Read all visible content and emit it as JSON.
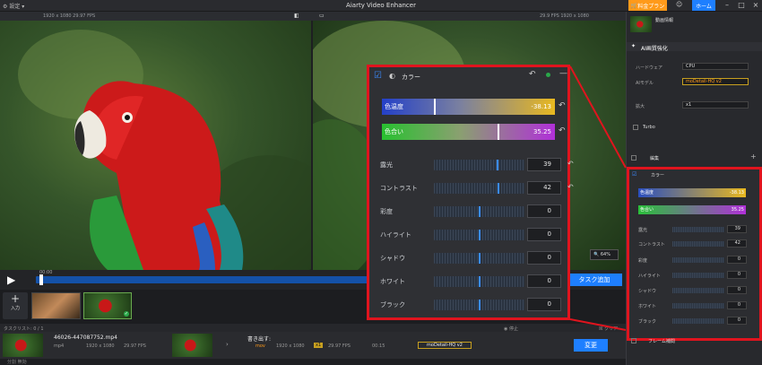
{
  "app": {
    "title": "Aiarty Video Enhancer",
    "settings_label": "設定",
    "plan_label": "料金プラン",
    "home_label": "ホーム"
  },
  "info": {
    "left_res": "1920 x 1080  29.97 FPS",
    "right_res": "29.9 FPS 1920 x 1080"
  },
  "timeline": {
    "time": "00:00"
  },
  "zoom": {
    "level": "64%"
  },
  "task_add_label": "タスク追加",
  "add_label": "入力",
  "tasklist": {
    "label": "タスクリスト: 0 / 1",
    "stop": "停止",
    "clear": "クリア"
  },
  "task": {
    "filename": "46026-447087752.mp4",
    "format": "mp4",
    "res": "1920 x 1080",
    "fps": "29.97 FPS",
    "export_title": "書き出す:",
    "export_format": "mov",
    "export_res": "1920 x 1080",
    "export_fps": "29.97 FPS",
    "export_dur": "00:15",
    "model": "moDetail-HQ v2",
    "change_label": "変更",
    "disabled_label": "分割 無効"
  },
  "color_panel": {
    "title": "カラー",
    "temperature": {
      "label": "色温度",
      "value": "-38.13"
    },
    "tint": {
      "label": "色合い",
      "value": "35.25"
    },
    "rows": [
      {
        "label": "露光",
        "value": "39"
      },
      {
        "label": "コントラスト",
        "value": "42"
      },
      {
        "label": "彩度",
        "value": "0"
      },
      {
        "label": "ハイライト",
        "value": "0"
      },
      {
        "label": "シャドウ",
        "value": "0"
      },
      {
        "label": "ホワイト",
        "value": "0"
      },
      {
        "label": "ブラック",
        "value": "0"
      }
    ]
  },
  "sidebar": {
    "ai_title": "AI画質強化",
    "hardware_label": "ハードウェア",
    "hardware_value": "CPU",
    "model_label": "AIモデル",
    "model_value": "moDetail-HQ v2",
    "scale_label": "拡大",
    "scale_value": "x1",
    "turbo_label": "Turbo",
    "edit_label": "編集",
    "frame_label": "フレーム補間",
    "preset_label": "動画情報"
  },
  "colors": {
    "accent": "#1e7fff",
    "orange": "#ff9a1a",
    "highlight": "#e0141e"
  }
}
